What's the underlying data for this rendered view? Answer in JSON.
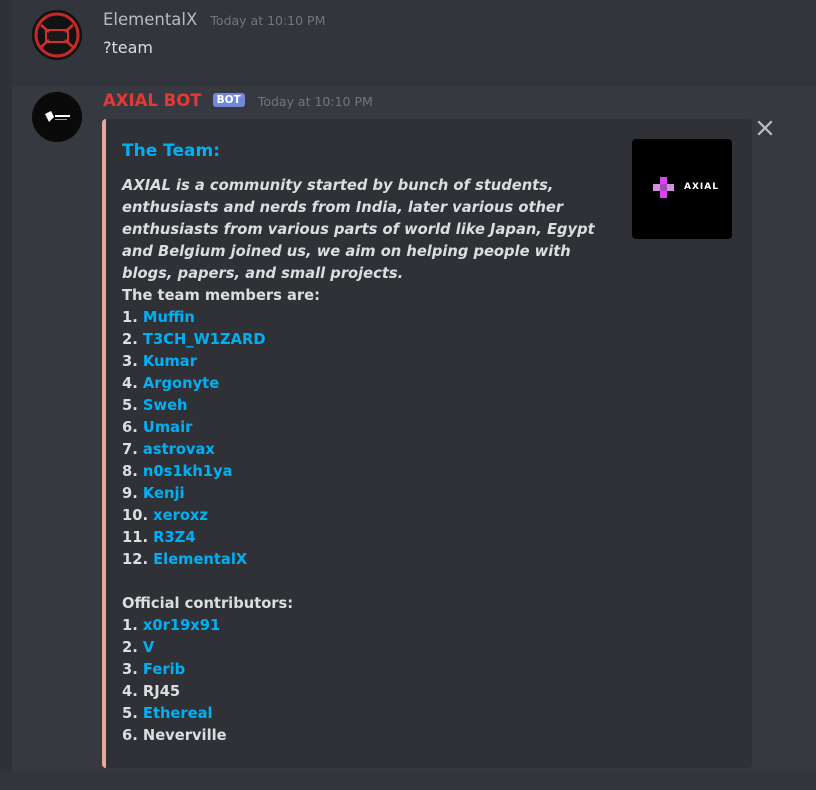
{
  "messages": {
    "first": {
      "username": "ElementalX",
      "timestamp": "Today at 10:10 PM",
      "text": "?team"
    },
    "second": {
      "username": "AXIAL BOT",
      "badge": "BOT",
      "timestamp": "Today at 10:10 PM",
      "embed": {
        "title": "The Team:",
        "description": "AXIAL is a community started by bunch of students, enthusiasts and nerds from India, later various other enthusiasts from various parts of world like Japan, Egypt and Belgium joined us, we aim on helping people with blogs, papers, and small projects.",
        "members_heading": "The team members are:",
        "members": [
          {
            "num": "1.",
            "name": "Muffin"
          },
          {
            "num": "2.",
            "name": "T3CH_W1ZARD"
          },
          {
            "num": "3.",
            "name": "Kumar"
          },
          {
            "num": "4.",
            "name": "Argonyte"
          },
          {
            "num": "5.",
            "name": "Sweh"
          },
          {
            "num": "6.",
            "name": "Umair"
          },
          {
            "num": "7.",
            "name": "astrovax"
          },
          {
            "num": "8.",
            "name": "n0s1kh1ya"
          },
          {
            "num": "9.",
            "name": "Kenji"
          },
          {
            "num": "10.",
            "name": "xeroxz"
          },
          {
            "num": "11.",
            "name": "R3Z4"
          },
          {
            "num": "12.",
            "name": "ElementalX"
          }
        ],
        "contributors_heading": "Official contributors:",
        "contributors": [
          {
            "num": "1.",
            "name": "x0r19x91",
            "link": true
          },
          {
            "num": "2.",
            "name": "V",
            "link": true
          },
          {
            "num": "3.",
            "name": "Ferib",
            "link": true
          },
          {
            "num": "4.",
            "name": "RJ45",
            "link": false
          },
          {
            "num": "5.",
            "name": "Ethereal",
            "link": true
          },
          {
            "num": "6.",
            "name": "Neverville",
            "link": false
          }
        ],
        "thumbnail_text": "AXIAL",
        "accent_color": "#e8a79a"
      }
    }
  },
  "colors": {
    "background": "#36393f",
    "link": "#00b0f4",
    "bot_name": "#e53935",
    "bot_badge": "#7289da"
  },
  "icons": {
    "close": "close-icon",
    "thumbnail": "axial-logo-icon"
  }
}
